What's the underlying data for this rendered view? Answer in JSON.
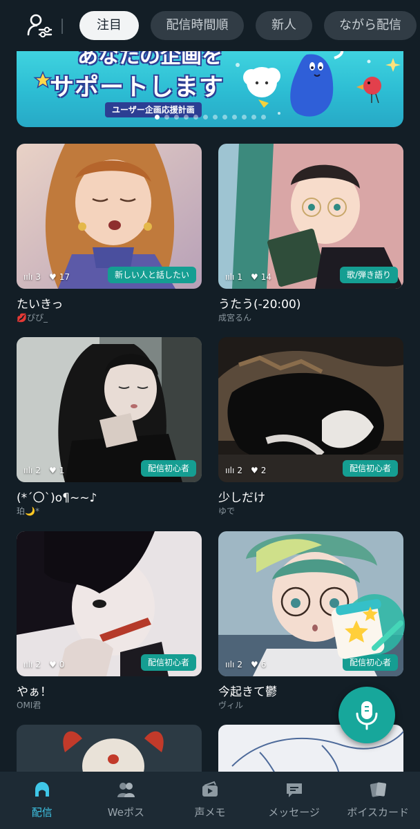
{
  "tabs": [
    "注目",
    "配信時間順",
    "新人",
    "ながら配信"
  ],
  "banner": {
    "top_text": "あなたの企画を",
    "headline": "サポートします",
    "subtitle": "ユーザー企画応援計画"
  },
  "cards": [
    {
      "title": "たいきっ",
      "host": "💋ぴぴ_",
      "listeners": "3",
      "likes": "17",
      "tag": "新しい人と話したい"
    },
    {
      "title": "うたう(-20:00)",
      "host": "成宮るん",
      "listeners": "1",
      "likes": "14",
      "tag": "歌/弾き語り"
    },
    {
      "title": "(*´〇`)o¶~~♪",
      "host": "珀🌙*",
      "listeners": "2",
      "likes": "1",
      "tag": "配信初心者"
    },
    {
      "title": "少しだけ",
      "host": "ゆで",
      "listeners": "2",
      "likes": "2",
      "tag": "配信初心者"
    },
    {
      "title": "やぁ！",
      "host": "OMI君",
      "listeners": "2",
      "likes": "0",
      "tag": "配信初心者"
    },
    {
      "title": "今起きて鬱",
      "host": "ヴィル",
      "listeners": "2",
      "likes": "6",
      "tag": "配信初心者"
    }
  ],
  "nav": [
    {
      "label": "配信",
      "icon": "live-icon"
    },
    {
      "label": "Weポス",
      "icon": "people-icon"
    },
    {
      "label": "声メモ",
      "icon": "voice-memo-icon"
    },
    {
      "label": "メッセージ",
      "icon": "message-icon"
    },
    {
      "label": "ボイスカード",
      "icon": "voice-card-icon"
    }
  ],
  "colors": {
    "background": "#131e26",
    "accent": "#17a79b",
    "tag": "#159e92",
    "nav_active": "#3fc7e8"
  }
}
